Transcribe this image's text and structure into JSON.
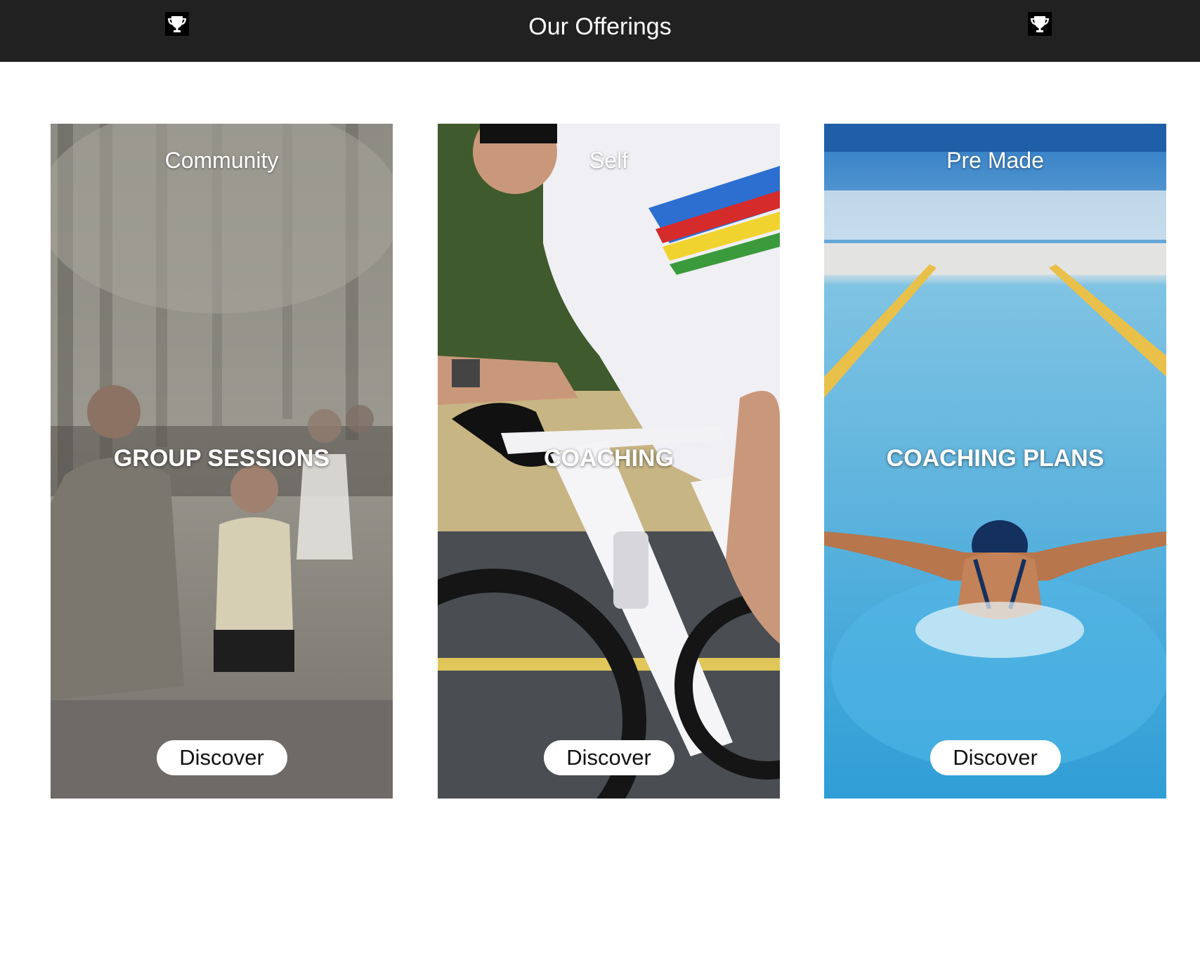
{
  "header": {
    "title": "Our Offerings",
    "left_icon": "trophy-icon",
    "right_icon": "trophy-icon",
    "background_color": "#212121"
  },
  "cards": [
    {
      "eyebrow": "Community",
      "title": "GROUP SESSIONS",
      "button_label": "Discover",
      "image": "group-running-photo"
    },
    {
      "eyebrow": "Self",
      "title": "COACHING",
      "button_label": "Discover",
      "image": "road-cyclist-photo"
    },
    {
      "eyebrow": "Pre Made",
      "title": "COACHING PLANS",
      "button_label": "Discover",
      "image": "butterfly-swimmer-photo"
    }
  ]
}
